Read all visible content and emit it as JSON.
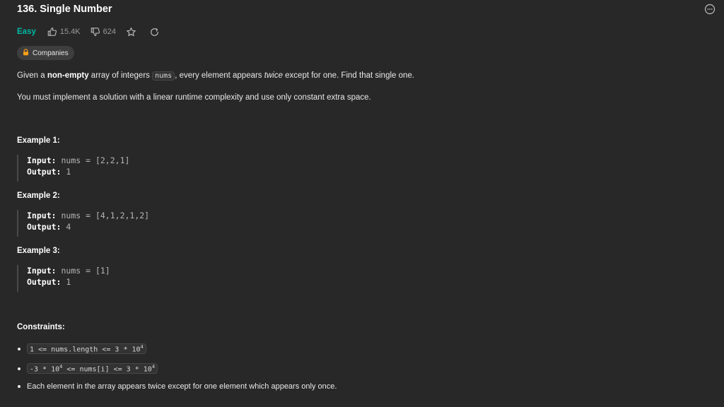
{
  "problem": {
    "title": "136. Single Number",
    "difficulty": "Easy",
    "likes": "15.4K",
    "dislikes": "624",
    "companies_label": "Companies"
  },
  "description": {
    "p1_before": "Given a ",
    "p1_bold": "non-empty",
    "p1_mid": " array of integers ",
    "p1_code": "nums",
    "p1_after1": ", every element appears ",
    "p1_italic": "twice",
    "p1_after2": " except for one. Find that single one.",
    "p2": "You must implement a solution with a linear runtime complexity and use only constant extra space."
  },
  "labels": {
    "input": "Input:",
    "output": "Output:"
  },
  "examples": [
    {
      "title": "Example 1:",
      "input": "nums = [2,2,1]",
      "output": "1"
    },
    {
      "title": "Example 2:",
      "input": "nums = [4,1,2,1,2]",
      "output": "4"
    },
    {
      "title": "Example 3:",
      "input": "nums = [1]",
      "output": "1"
    }
  ],
  "constraints": {
    "title": "Constraints:",
    "c1_pre": "1 <= nums.length <= 3 * 10",
    "c1_sup": "4",
    "c2_pre": "-3 * 10",
    "c2_sup1": "4",
    "c2_mid": " <= nums[i] <= 3 * 10",
    "c2_sup2": "4",
    "c3": "Each element in the array appears twice except for one element which appears only once."
  },
  "colors": {
    "background": "#282828",
    "easy": "#00b8a3",
    "lock": "#ffa116"
  },
  "icons": [
    "thumbs-up-icon",
    "thumbs-down-icon",
    "star-icon",
    "refresh-icon",
    "more-options-icon",
    "lock-icon"
  ]
}
